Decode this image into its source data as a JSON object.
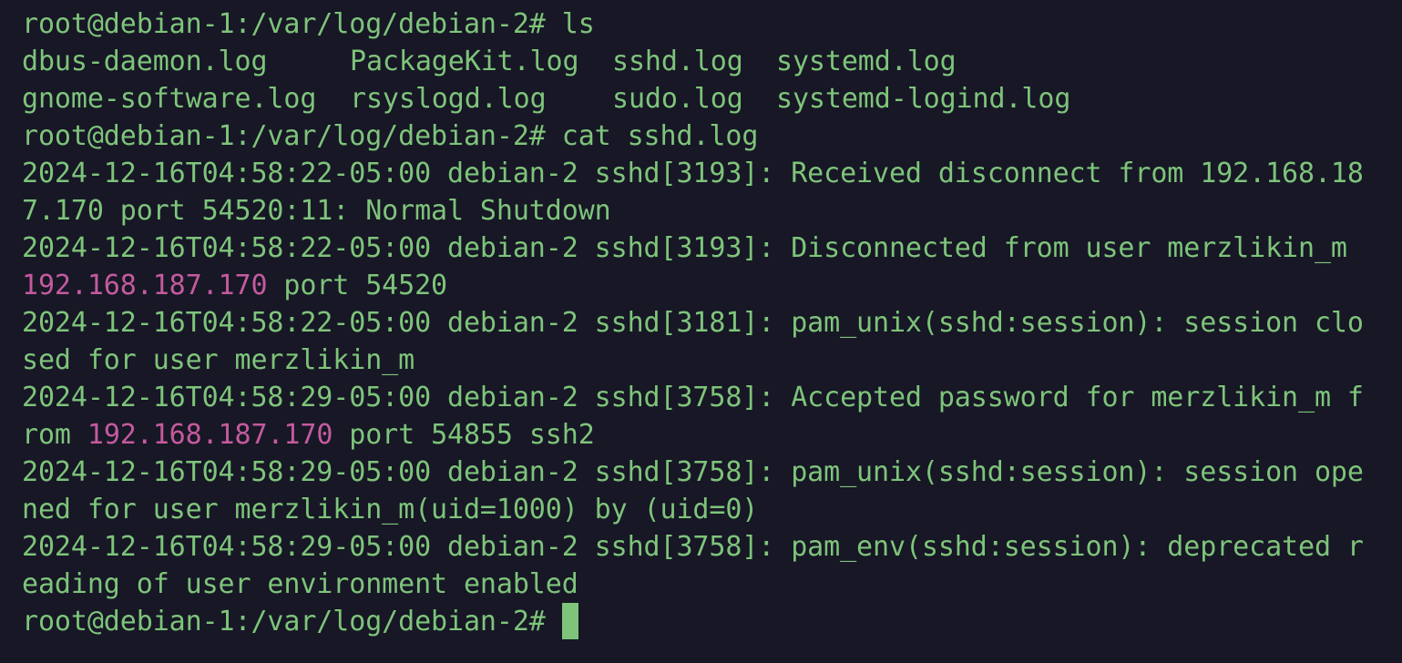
{
  "prompt": "root@debian-1:/var/log/debian-2#",
  "commands": [
    "ls",
    "cat sshd.log"
  ],
  "ls_output": [
    [
      "dbus-daemon.log",
      "PackageKit.log",
      "sshd.log",
      "systemd.log"
    ],
    [
      "gnome-software.log",
      "rsyslogd.log",
      "sudo.log",
      "systemd-logind.log"
    ]
  ],
  "log_lines": [
    {
      "pre": "2024-12-16T04:58:22-05:00 debian-2 sshd[3193]: Received disconnect from 192.168.18",
      "ip": "",
      "post": ""
    },
    {
      "pre": "7.170 port 54520:11: Normal Shutdown",
      "ip": "",
      "post": ""
    },
    {
      "pre": "2024-12-16T04:58:22-05:00 debian-2 sshd[3193]: Disconnected from user merzlikin_m",
      "ip": "",
      "post": ""
    },
    {
      "pre": "",
      "ip": "192.168.187.170",
      "post": " port 54520"
    },
    {
      "pre": "2024-12-16T04:58:22-05:00 debian-2 sshd[3181]: pam_unix(sshd:session): session clo",
      "ip": "",
      "post": ""
    },
    {
      "pre": "sed for user merzlikin_m",
      "ip": "",
      "post": ""
    },
    {
      "pre": "2024-12-16T04:58:29-05:00 debian-2 sshd[3758]: Accepted password for merzlikin_m f",
      "ip": "",
      "post": ""
    },
    {
      "pre": "rom ",
      "ip": "192.168.187.170",
      "post": " port 54855 ssh2"
    },
    {
      "pre": "2024-12-16T04:58:29-05:00 debian-2 sshd[3758]: pam_unix(sshd:session): session ope",
      "ip": "",
      "post": ""
    },
    {
      "pre": "ned for user merzlikin_m(uid=1000) by (uid=0)",
      "ip": "",
      "post": ""
    },
    {
      "pre": "2024-12-16T04:58:29-05:00 debian-2 sshd[3758]: pam_env(sshd:session): deprecated r",
      "ip": "",
      "post": ""
    },
    {
      "pre": "eading of user environment enabled",
      "ip": "",
      "post": ""
    }
  ],
  "colors": {
    "background": "#171726",
    "text": "#7ec47a",
    "ip_highlight": "#c45a9e",
    "cursor": "#7ec47a"
  }
}
